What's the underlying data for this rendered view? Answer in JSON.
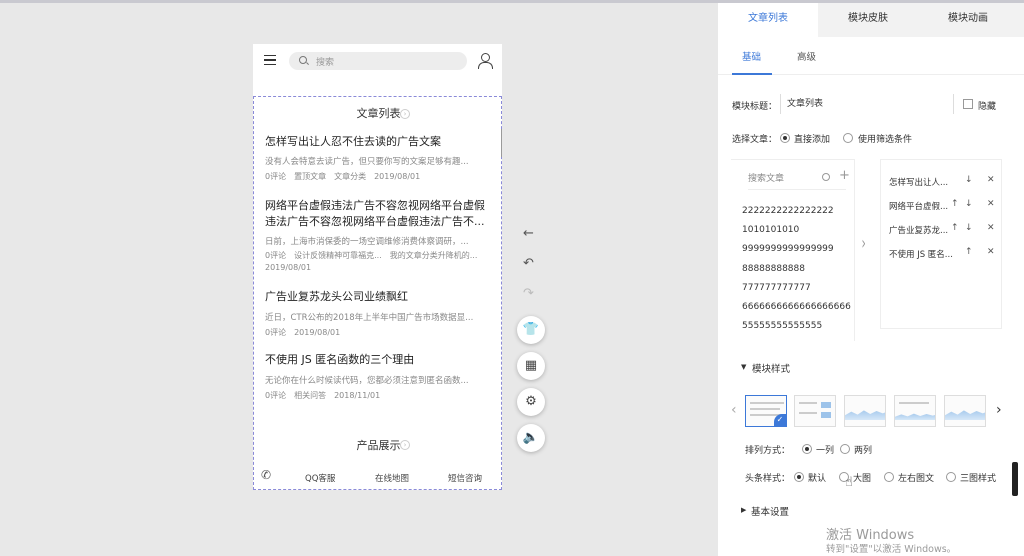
{
  "phone": {
    "search_placeholder": "搜索",
    "article_module": {
      "title": "文章列表",
      "articles": [
        {
          "title": "怎样写出让人忍不住去读的广告文案",
          "summary": "没有人会特意去读广告，但只要你写的文案足够有趣...",
          "meta": [
            "0评论",
            "置顶文章",
            "文章分类",
            "2019/08/01"
          ]
        },
        {
          "title": "网络平台虚假违法广告不容忽视网络平台虚假违法广告不容忽视网络平台虚假违法广告不...",
          "summary": "日前，上海市消保委的一场空调维修消费体察调研，...",
          "meta": [
            "0评论",
            "设计反馈精神可靠福克...",
            "我的文章分类升降机的..."
          ],
          "meta_date": "2019/08/01"
        },
        {
          "title": "广告业复苏龙头公司业绩飘红",
          "summary": "近日，CTR公布的2018年上半年中国广告市场数据显...",
          "meta": [
            "0评论",
            "2019/08/01"
          ]
        },
        {
          "title": "不使用 JS 匿名函数的三个理由",
          "summary": "无论你在什么时候读代码，您都必须注意到匿名函数...",
          "meta": [
            "0评论",
            "相关问答",
            "2018/11/01"
          ]
        }
      ]
    },
    "product_module": {
      "title": "产品展示"
    },
    "footer": {
      "links": [
        "QQ客服",
        "在线地图",
        "短信咨询"
      ]
    }
  },
  "tools": {
    "icons": [
      "back-arrow-icon",
      "undo-icon",
      "redo-icon",
      "tshirt-icon",
      "grid-icon",
      "settings-icon",
      "speaker-icon"
    ]
  },
  "panel": {
    "tabs": [
      "文章列表",
      "模块皮肤",
      "模块动画"
    ],
    "active_tab": "文章列表",
    "subtabs": [
      "基础",
      "高级"
    ],
    "module_title_label": "模块标题：",
    "module_title_value": "文章列表",
    "hide_label": "隐藏",
    "select_article_label": "选择文章：",
    "select_options": [
      "直接添加",
      "使用筛选条件"
    ],
    "search_article_placeholder": "搜索文章",
    "source_articles": [
      "2222222222222222",
      "1010101010",
      "9999999999999999",
      "88888888888",
      "777777777777",
      "6666666666666666666",
      "55555555555555"
    ],
    "selected_articles": [
      "怎样写出让人...",
      "网络平台虚假...",
      "广告业复苏龙...",
      "不使用 JS 匿名..."
    ],
    "module_style_title": "模块样式",
    "arrange_label": "排列方式：",
    "arrange_options": [
      "一列",
      "两列"
    ],
    "headline_label": "头条样式：",
    "headline_options": [
      "默认",
      "大图",
      "左右图文",
      "三图样式"
    ],
    "basic_settings_title": "基本设置"
  },
  "system": {
    "activate_title": "激活 Windows",
    "activate_sub": "转到\"设置\"以激活 Windows。"
  },
  "colors": {
    "accent": "#3c78d8",
    "border_dashed": "#8a8ad8",
    "panel_bg": "#ffffff",
    "canvas_bg": "#e8e8e8"
  }
}
